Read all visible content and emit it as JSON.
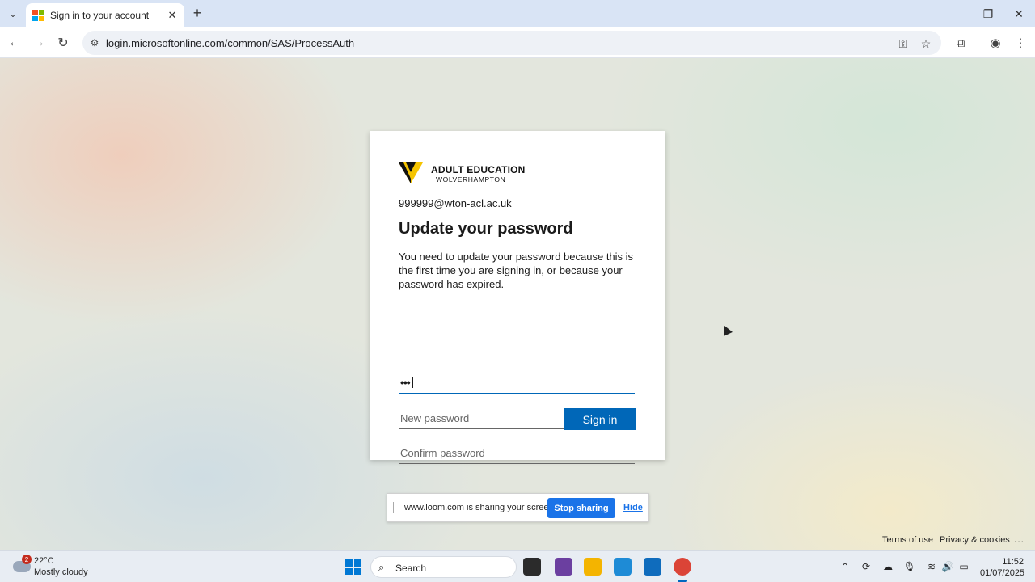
{
  "browser": {
    "tab_title": "Sign in to your account",
    "url": "login.microsoftonline.com/common/SAS/ProcessAuth",
    "icons": [
      "tab-list-icon",
      "microsoft-favicon-icon",
      "close-tab-icon",
      "new-tab-icon",
      "back-icon",
      "forward-icon",
      "reload-icon",
      "site-info-icon",
      "password-key-icon",
      "bookmark-star-icon",
      "extensions-icon",
      "profile-icon",
      "menu-icon",
      "minimize-icon",
      "restore-icon",
      "close-window-icon"
    ]
  },
  "card": {
    "logo": {
      "line1": "ADULT EDUCATION",
      "line2": "WOLVERHAMPTON",
      "mark_colors": [
        "#f5c400",
        "#111111"
      ]
    },
    "identity": "999999@wton-acl.ac.uk",
    "heading": "Update your password",
    "description": "You need to update your password because this is the first time you are signing in, or because your password has expired.",
    "current_password_value": "•••",
    "new_password_placeholder": "New password",
    "confirm_password_placeholder": "Confirm password",
    "signin_label": "Sign in",
    "accent_color": "#0067b8"
  },
  "share_bar": {
    "message": "www.loom.com is sharing your screen.",
    "stop_label": "Stop sharing",
    "hide_label": "Hide"
  },
  "footer": {
    "terms": "Terms of use",
    "privacy": "Privacy & cookies",
    "more": "..."
  },
  "taskbar": {
    "weather_badge": "2",
    "temperature": "22°C",
    "condition": "Mostly cloudy",
    "search_label": "Search",
    "time": "11:52",
    "date": "01/07/2025"
  }
}
